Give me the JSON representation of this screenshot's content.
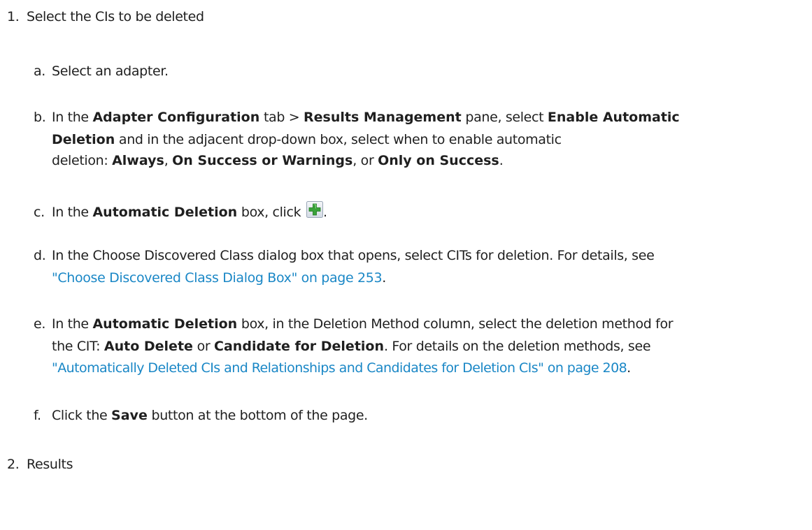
{
  "step1": {
    "marker": "1.",
    "title": "Select the CIs to be deleted",
    "substeps": {
      "a": {
        "marker": "a.",
        "text": "Select an adapter."
      },
      "b": {
        "marker": "b.",
        "t1": "In the ",
        "b1": "Adapter Configuration",
        "t2": " tab > ",
        "b2": "Results Management",
        "t3": " pane, select ",
        "b3": "Enable Automatic",
        "b4": "Deletion",
        "t4": " and in the adjacent drop-down box, select when to enable automatic",
        "t5": "deletion: ",
        "b5": "Always",
        "t6": ", ",
        "b6": "On Success or Warnings",
        "t7": ", or ",
        "b7": "Only on Success",
        "t8": "."
      },
      "c": {
        "marker": "c.",
        "t1": "In the ",
        "b1": "Automatic Deletion",
        "t2": " box, click ",
        "t3": ".",
        "icon": "add-plus-icon",
        "icon_color": "#3aa23a"
      },
      "d": {
        "marker": "d.",
        "t1": "In the Choose Discovered Class dialog box that opens, select CITs for deletion. For details, see",
        "link": "\"Choose Discovered Class Dialog Box\" on page 253",
        "t2": "."
      },
      "e": {
        "marker": "e.",
        "t1": "In the ",
        "b1": "Automatic Deletion",
        "t2": " box, in the Deletion Method column, select the deletion method for",
        "t3": "the CIT: ",
        "b2": "Auto Delete",
        "t4": " or ",
        "b3": "Candidate for Deletion",
        "t5": ". For details on the deletion methods, see",
        "link": "\"Automatically Deleted CIs and Relationships and Candidates for Deletion CIs\" on page 208",
        "t6": "."
      },
      "f": {
        "marker": "f.",
        "t1": "Click the ",
        "b1": "Save",
        "t2": " button at the bottom of the page."
      }
    }
  },
  "step2": {
    "marker": "2.",
    "title": "Results"
  },
  "colors": {
    "text": "#1f1f1f",
    "link": "#1a87c6"
  }
}
